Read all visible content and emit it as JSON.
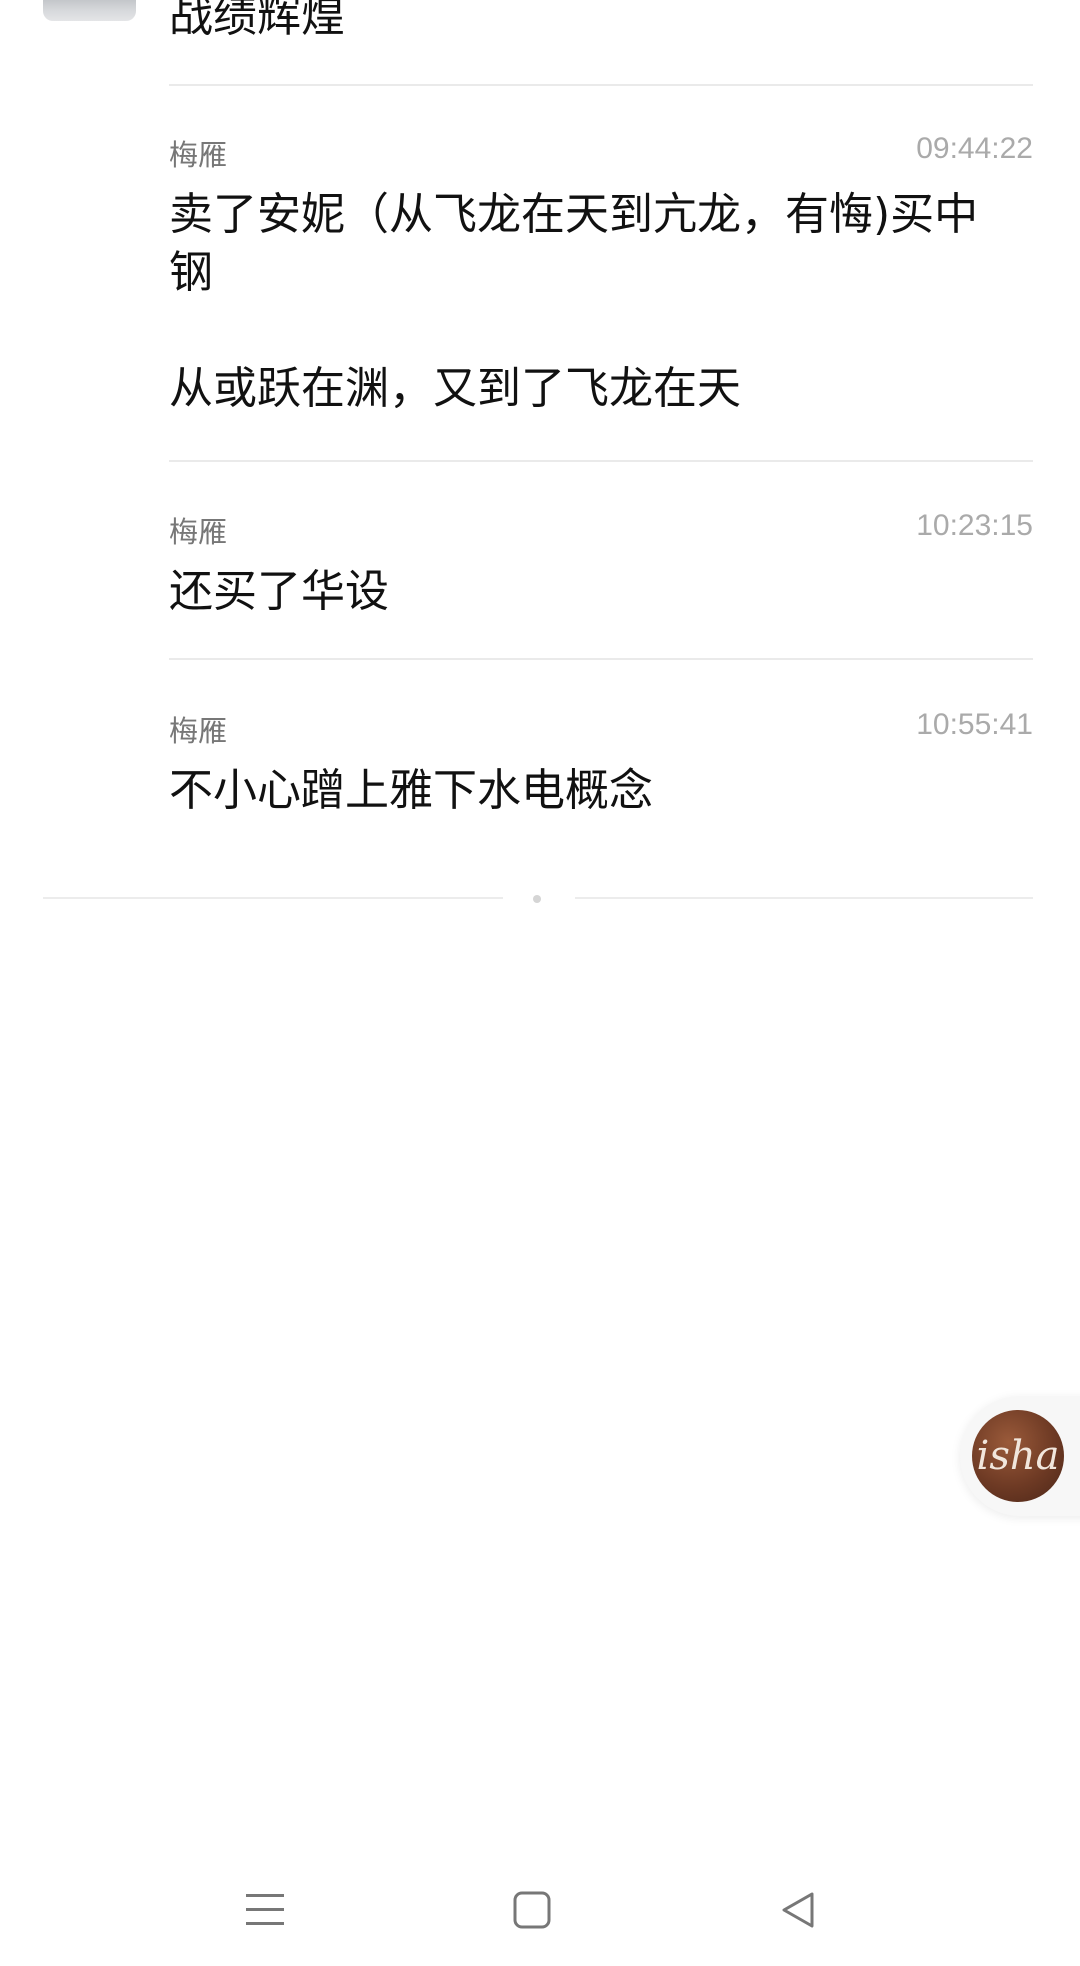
{
  "prev_message": {
    "text": "战绩辉煌"
  },
  "messages": [
    {
      "sender": "梅雁",
      "time": "09:44:22",
      "text": "卖了安妮（从飞龙在天到亢龙，有悔)买中\n钢\n\n从或跃在渊，又到了飞龙在天"
    },
    {
      "sender": "梅雁",
      "time": "10:23:15",
      "text": "还买了华设"
    },
    {
      "sender": "梅雁",
      "time": "10:55:41",
      "text": "不小心蹭上雅下水电概念"
    }
  ],
  "floating_button": {
    "label": "isha"
  },
  "navbar": {
    "icons": [
      "menu-icon",
      "home-square-icon",
      "back-triangle-icon"
    ]
  }
}
